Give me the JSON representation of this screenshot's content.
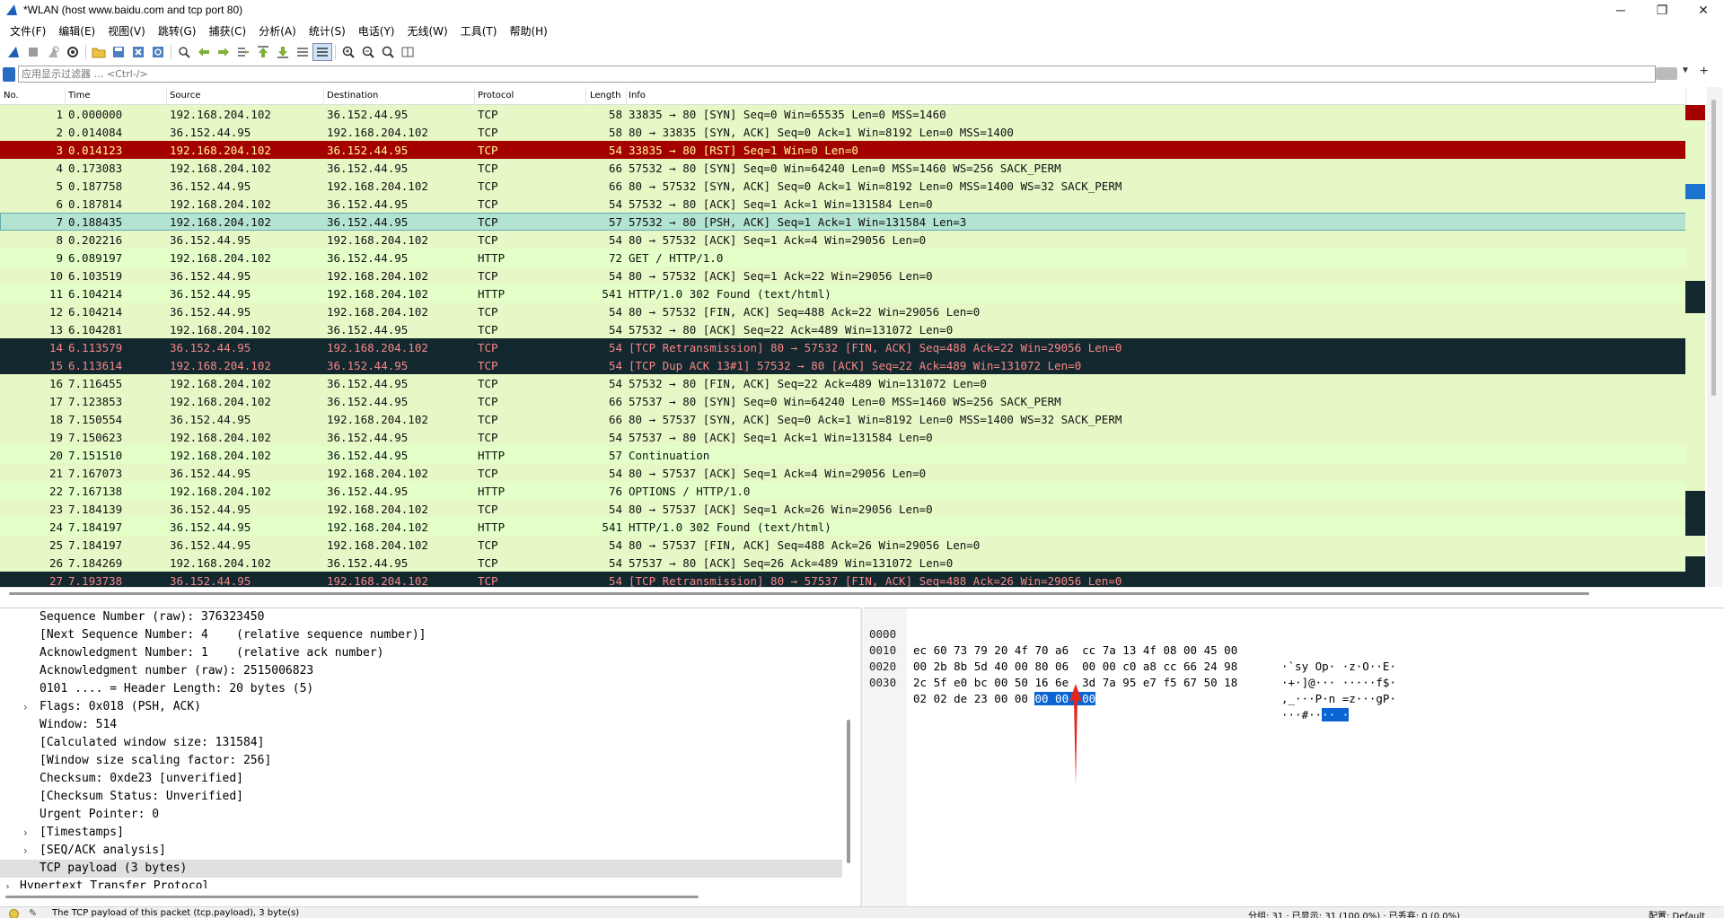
{
  "window": {
    "title": "*WLAN (host www.baidu.com and tcp port 80)",
    "minimize": "─",
    "maximize": "❐",
    "close": "✕"
  },
  "menu": [
    "文件(F)",
    "编辑(E)",
    "视图(V)",
    "跳转(G)",
    "捕获(C)",
    "分析(A)",
    "统计(S)",
    "电话(Y)",
    "无线(W)",
    "工具(T)",
    "帮助(H)"
  ],
  "toolbar": {
    "icons": [
      "shark-fin-start-icon",
      "stop-square-icon",
      "restart-fin-icon",
      "gear-options-icon",
      "open-folder-icon",
      "save-file-icon",
      "close-file-icon",
      "reload-icon",
      "find-icon",
      "back-arrow-icon",
      "forward-arrow-icon",
      "go-to-packet-icon",
      "first-packet-icon",
      "last-packet-icon",
      "autoscroll-icon",
      "colorize-icon",
      "zoom-in-icon",
      "zoom-out-icon",
      "normal-size-icon",
      "resize-columns-icon"
    ]
  },
  "filter": {
    "placeholder": "应用显示过滤器 … <Ctrl-/>"
  },
  "packet_list": {
    "columns": [
      "No.",
      "Time",
      "Source",
      "Destination",
      "Protocol",
      "Length",
      "Info"
    ],
    "rows": [
      {
        "no": "1",
        "time": "0.000000",
        "src": "192.168.204.102",
        "dst": "36.152.44.95",
        "proto": "TCP",
        "len": "58",
        "info": "33835 → 80 [SYN] Seq=0 Win=65535 Len=0 MSS=1460",
        "style": "tcp"
      },
      {
        "no": "2",
        "time": "0.014084",
        "src": "36.152.44.95",
        "dst": "192.168.204.102",
        "proto": "TCP",
        "len": "58",
        "info": "80 → 33835 [SYN, ACK] Seq=0 Ack=1 Win=8192 Len=0 MSS=1400",
        "style": "tcp"
      },
      {
        "no": "3",
        "time": "0.014123",
        "src": "192.168.204.102",
        "dst": "36.152.44.95",
        "proto": "TCP",
        "len": "54",
        "info": "33835 → 80 [RST] Seq=1 Win=0 Len=0",
        "style": "rst"
      },
      {
        "no": "4",
        "time": "0.173083",
        "src": "192.168.204.102",
        "dst": "36.152.44.95",
        "proto": "TCP",
        "len": "66",
        "info": "57532 → 80 [SYN] Seq=0 Win=64240 Len=0 MSS=1460 WS=256 SACK_PERM",
        "style": "tcp"
      },
      {
        "no": "5",
        "time": "0.187758",
        "src": "36.152.44.95",
        "dst": "192.168.204.102",
        "proto": "TCP",
        "len": "66",
        "info": "80 → 57532 [SYN, ACK] Seq=0 Ack=1 Win=8192 Len=0 MSS=1400 WS=32 SACK_PERM",
        "style": "tcp"
      },
      {
        "no": "6",
        "time": "0.187814",
        "src": "192.168.204.102",
        "dst": "36.152.44.95",
        "proto": "TCP",
        "len": "54",
        "info": "57532 → 80 [ACK] Seq=1 Ack=1 Win=131584 Len=0",
        "style": "tcp"
      },
      {
        "no": "7",
        "time": "0.188435",
        "src": "192.168.204.102",
        "dst": "36.152.44.95",
        "proto": "TCP",
        "len": "57",
        "info": "57532 → 80 [PSH, ACK] Seq=1 Ack=1 Win=131584 Len=3",
        "style": "sel"
      },
      {
        "no": "8",
        "time": "0.202216",
        "src": "36.152.44.95",
        "dst": "192.168.204.102",
        "proto": "TCP",
        "len": "54",
        "info": "80 → 57532 [ACK] Seq=1 Ack=4 Win=29056 Len=0",
        "style": "tcp"
      },
      {
        "no": "9",
        "time": "6.089197",
        "src": "192.168.204.102",
        "dst": "36.152.44.95",
        "proto": "HTTP",
        "len": "72",
        "info": "GET / HTTP/1.0",
        "style": "http"
      },
      {
        "no": "10",
        "time": "6.103519",
        "src": "36.152.44.95",
        "dst": "192.168.204.102",
        "proto": "TCP",
        "len": "54",
        "info": "80 → 57532 [ACK] Seq=1 Ack=22 Win=29056 Len=0",
        "style": "tcp"
      },
      {
        "no": "11",
        "time": "6.104214",
        "src": "36.152.44.95",
        "dst": "192.168.204.102",
        "proto": "HTTP",
        "len": "541",
        "info": "HTTP/1.0 302 Found  (text/html)",
        "style": "http"
      },
      {
        "no": "12",
        "time": "6.104214",
        "src": "36.152.44.95",
        "dst": "192.168.204.102",
        "proto": "TCP",
        "len": "54",
        "info": "80 → 57532 [FIN, ACK] Seq=488 Ack=22 Win=29056 Len=0",
        "style": "tcp"
      },
      {
        "no": "13",
        "time": "6.104281",
        "src": "192.168.204.102",
        "dst": "36.152.44.95",
        "proto": "TCP",
        "len": "54",
        "info": "57532 → 80 [ACK] Seq=22 Ack=489 Win=131072 Len=0",
        "style": "tcp"
      },
      {
        "no": "14",
        "time": "6.113579",
        "src": "36.152.44.95",
        "dst": "192.168.204.102",
        "proto": "TCP",
        "len": "54",
        "info": "[TCP Retransmission] 80 → 57532 [FIN, ACK] Seq=488 Ack=22 Win=29056 Len=0",
        "style": "bad"
      },
      {
        "no": "15",
        "time": "6.113614",
        "src": "192.168.204.102",
        "dst": "36.152.44.95",
        "proto": "TCP",
        "len": "54",
        "info": "[TCP Dup ACK 13#1] 57532 → 80 [ACK] Seq=22 Ack=489 Win=131072 Len=0",
        "style": "bad"
      },
      {
        "no": "16",
        "time": "7.116455",
        "src": "192.168.204.102",
        "dst": "36.152.44.95",
        "proto": "TCP",
        "len": "54",
        "info": "57532 → 80 [FIN, ACK] Seq=22 Ack=489 Win=131072 Len=0",
        "style": "tcp"
      },
      {
        "no": "17",
        "time": "7.123853",
        "src": "192.168.204.102",
        "dst": "36.152.44.95",
        "proto": "TCP",
        "len": "66",
        "info": "57537 → 80 [SYN] Seq=0 Win=64240 Len=0 MSS=1460 WS=256 SACK_PERM",
        "style": "tcp"
      },
      {
        "no": "18",
        "time": "7.150554",
        "src": "36.152.44.95",
        "dst": "192.168.204.102",
        "proto": "TCP",
        "len": "66",
        "info": "80 → 57537 [SYN, ACK] Seq=0 Ack=1 Win=8192 Len=0 MSS=1400 WS=32 SACK_PERM",
        "style": "tcp"
      },
      {
        "no": "19",
        "time": "7.150623",
        "src": "192.168.204.102",
        "dst": "36.152.44.95",
        "proto": "TCP",
        "len": "54",
        "info": "57537 → 80 [ACK] Seq=1 Ack=1 Win=131584 Len=0",
        "style": "tcp"
      },
      {
        "no": "20",
        "time": "7.151510",
        "src": "192.168.204.102",
        "dst": "36.152.44.95",
        "proto": "HTTP",
        "len": "57",
        "info": "Continuation",
        "style": "http"
      },
      {
        "no": "21",
        "time": "7.167073",
        "src": "36.152.44.95",
        "dst": "192.168.204.102",
        "proto": "TCP",
        "len": "54",
        "info": "80 → 57537 [ACK] Seq=1 Ack=4 Win=29056 Len=0",
        "style": "tcp"
      },
      {
        "no": "22",
        "time": "7.167138",
        "src": "192.168.204.102",
        "dst": "36.152.44.95",
        "proto": "HTTP",
        "len": "76",
        "info": "OPTIONS / HTTP/1.0",
        "style": "http"
      },
      {
        "no": "23",
        "time": "7.184139",
        "src": "36.152.44.95",
        "dst": "192.168.204.102",
        "proto": "TCP",
        "len": "54",
        "info": "80 → 57537 [ACK] Seq=1 Ack=26 Win=29056 Len=0",
        "style": "tcp"
      },
      {
        "no": "24",
        "time": "7.184197",
        "src": "36.152.44.95",
        "dst": "192.168.204.102",
        "proto": "HTTP",
        "len": "541",
        "info": "HTTP/1.0 302 Found  (text/html)",
        "style": "http"
      },
      {
        "no": "25",
        "time": "7.184197",
        "src": "36.152.44.95",
        "dst": "192.168.204.102",
        "proto": "TCP",
        "len": "54",
        "info": "80 → 57537 [FIN, ACK] Seq=488 Ack=26 Win=29056 Len=0",
        "style": "tcp"
      },
      {
        "no": "26",
        "time": "7.184269",
        "src": "192.168.204.102",
        "dst": "36.152.44.95",
        "proto": "TCP",
        "len": "54",
        "info": "57537 → 80 [ACK] Seq=26 Ack=489 Win=131072 Len=0",
        "style": "tcp"
      },
      {
        "no": "27",
        "time": "7.193738",
        "src": "36.152.44.95",
        "dst": "192.168.204.102",
        "proto": "TCP",
        "len": "54",
        "info": "[TCP Retransmission] 80 → 57537 [FIN, ACK] Seq=488 Ack=26 Win=29056 Len=0",
        "style": "bad"
      }
    ]
  },
  "details": {
    "lines": [
      {
        "text": "Sequence Number (raw): 376323450",
        "expand": "",
        "level": "child"
      },
      {
        "text": "[Next Sequence Number: 4    (relative sequence number)]",
        "expand": "",
        "level": "child"
      },
      {
        "text": "Acknowledgment Number: 1    (relative ack number)",
        "expand": "",
        "level": "child"
      },
      {
        "text": "Acknowledgment number (raw): 2515006823",
        "expand": "",
        "level": "child"
      },
      {
        "text": "0101 .... = Header Length: 20 bytes (5)",
        "expand": "",
        "level": "child"
      },
      {
        "text": "Flags: 0x018 (PSH, ACK)",
        "expand": "›",
        "level": "child"
      },
      {
        "text": "Window: 514",
        "expand": "",
        "level": "child"
      },
      {
        "text": "[Calculated window size: 131584]",
        "expand": "",
        "level": "child"
      },
      {
        "text": "[Window size scaling factor: 256]",
        "expand": "",
        "level": "child"
      },
      {
        "text": "Checksum: 0xde23 [unverified]",
        "expand": "",
        "level": "child"
      },
      {
        "text": "[Checksum Status: Unverified]",
        "expand": "",
        "level": "child"
      },
      {
        "text": "Urgent Pointer: 0",
        "expand": "",
        "level": "child"
      },
      {
        "text": "[Timestamps]",
        "expand": "›",
        "level": "child"
      },
      {
        "text": "[SEQ/ACK analysis]",
        "expand": "›",
        "level": "child"
      },
      {
        "text": "TCP payload (3 bytes)",
        "expand": "",
        "level": "child",
        "selected": true
      },
      {
        "text": "Hypertext Transfer Protocol",
        "expand": "›",
        "level": "top"
      }
    ]
  },
  "bytes": {
    "rows": [
      {
        "offset": "0000",
        "hex": "ec 60 73 79 20 4f 70 a6  cc 7a 13 4f 08 00 45 00",
        "ascii": "·`sy Op· ·z·O··E·"
      },
      {
        "offset": "0010",
        "hex": "00 2b 8b 5d 40 00 80 06  00 00 c0 a8 cc 66 24 98",
        "ascii": "·+·]@··· ·····f$·"
      },
      {
        "offset": "0020",
        "hex": "2c 5f e0 bc 00 50 16 6e  3d 7a 95 e7 f5 67 50 18",
        "ascii": ",_···P·n =z···gP·"
      },
      {
        "offset": "0030",
        "hex_pre": "02 02 de 23 00 00 ",
        "hex_hl": "00 00  00",
        "ascii_pre": "···#··",
        "ascii_hl": "·· ·"
      }
    ]
  },
  "status": {
    "message": "The TCP payload of this packet (tcp.payload), 3 byte(s)",
    "stats": "分组: 31 · 已显示: 31 (100.0%) · 已丢弃: 0 (0.0%)",
    "profile": "配置: Default"
  }
}
